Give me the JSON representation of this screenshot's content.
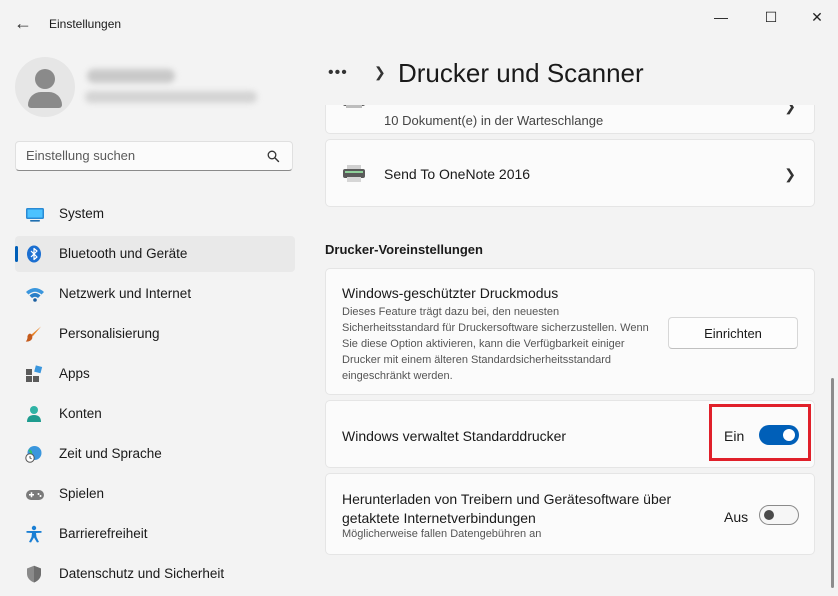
{
  "window": {
    "title": "Einstellungen",
    "controls": {
      "minimize": "—",
      "maximize": "☐",
      "close": "✕"
    }
  },
  "search": {
    "placeholder": "Einstellung suchen"
  },
  "nav": {
    "items": [
      {
        "label": "System",
        "icon": "system-icon"
      },
      {
        "label": "Bluetooth und Geräte",
        "icon": "bluetooth-icon",
        "active": true
      },
      {
        "label": "Netzwerk und Internet",
        "icon": "wifi-icon"
      },
      {
        "label": "Personalisierung",
        "icon": "brush-icon"
      },
      {
        "label": "Apps",
        "icon": "apps-icon"
      },
      {
        "label": "Konten",
        "icon": "account-icon"
      },
      {
        "label": "Zeit und Sprache",
        "icon": "globe-clock-icon"
      },
      {
        "label": "Spielen",
        "icon": "gamepad-icon"
      },
      {
        "label": "Barrierefreiheit",
        "icon": "accessibility-icon"
      },
      {
        "label": "Datenschutz und Sicherheit",
        "icon": "shield-icon"
      }
    ]
  },
  "header": {
    "breadcrumb_more": "•••",
    "title": "Drucker und Scanner"
  },
  "printers": [
    {
      "subtitle": "10 Dokument(e) in der Warteschlange"
    },
    {
      "name": "Send To OneNote 2016"
    }
  ],
  "section": {
    "title": "Drucker-Voreinstellungen"
  },
  "protected_mode": {
    "title": "Windows-geschützter Druckmodus",
    "description": "Dieses Feature trägt dazu bei, den neuesten Sicherheitsstandard für Druckersoftware sicherzustellen. Wenn Sie diese Option aktivieren, kann die Verfügbarkeit einiger Drucker mit einem älteren Standardsicherheitsstandard eingeschränkt werden.",
    "button": "Einrichten"
  },
  "default_printer": {
    "title": "Windows verwaltet Standarddrucker",
    "state": "Ein",
    "on": true
  },
  "metered": {
    "title": "Herunterladen von Treibern und Gerätesoftware über getaktete Internetverbindungen",
    "description": "Möglicherweise fallen Datengebühren an",
    "state": "Aus",
    "on": false
  },
  "colors": {
    "accent": "#005fb8",
    "highlight": "#e0202a"
  }
}
